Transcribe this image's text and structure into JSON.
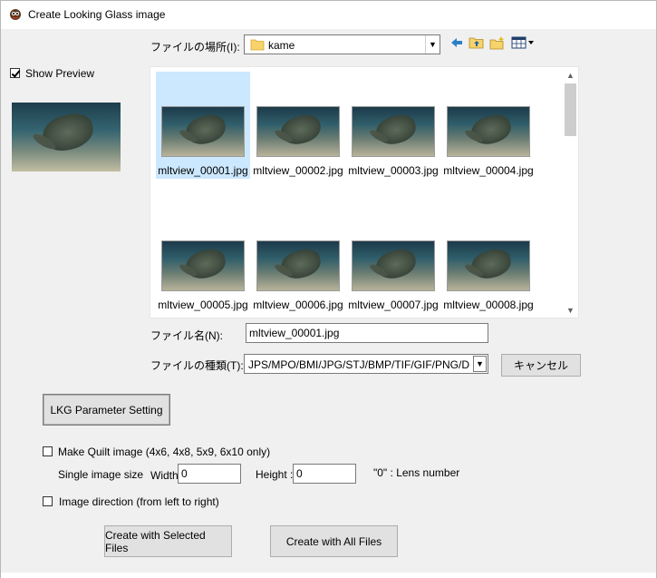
{
  "window": {
    "title": "Create Looking Glass image"
  },
  "colors": {
    "selection": "#cce8ff",
    "folder": "#f6d36b",
    "toolbar_icon": "#1a6fb5"
  },
  "show_preview": {
    "label": "Show Preview",
    "checked": true
  },
  "look_in": {
    "label": "ファイルの場所(I):",
    "value": "kame"
  },
  "toolbar": {
    "icons": [
      "back-arrow-icon",
      "up-folder-icon",
      "new-folder-icon",
      "view-menu-icon"
    ]
  },
  "files": [
    {
      "name": "mltview_00001.jpg",
      "selected": true
    },
    {
      "name": "mltview_00002.jpg",
      "selected": false
    },
    {
      "name": "mltview_00003.jpg",
      "selected": false
    },
    {
      "name": "mltview_00004.jpg",
      "selected": false
    },
    {
      "name": "mltview_00005.jpg",
      "selected": false
    },
    {
      "name": "mltview_00006.jpg",
      "selected": false
    },
    {
      "name": "mltview_00007.jpg",
      "selected": false
    },
    {
      "name": "mltview_00008.jpg",
      "selected": false
    }
  ],
  "file_name": {
    "label": "ファイル名(N):",
    "value": "mltview_00001.jpg"
  },
  "file_type": {
    "label": "ファイルの種類(T):",
    "value": "JPS/MPO/BMI/JPG/STJ/BMP/TIF/GIF/PNG/DAS"
  },
  "cancel_button": "キャンセル",
  "lkg_param_button": "LKG Parameter Setting",
  "quilt": {
    "label": "Make Quilt image (4x6, 4x8, 5x9, 6x10 only)",
    "checked": false,
    "single_size_label": "Single image size",
    "width_label": "Width",
    "width_value": "0",
    "height_label": "Height :",
    "height_value": "0",
    "lens_note": "\"0\" : Lens number"
  },
  "direction": {
    "label": "Image direction (from left to right)",
    "checked": false
  },
  "create_selected_button": "Create with Selected Files",
  "create_all_button": "Create with All Files"
}
